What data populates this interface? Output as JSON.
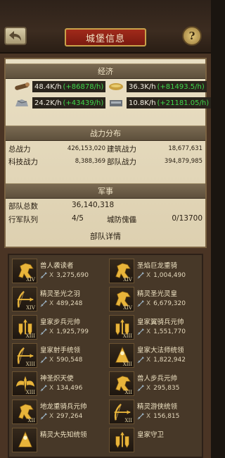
{
  "header": {
    "title": "城堡信息"
  },
  "economy": {
    "title": "经济",
    "resources": [
      {
        "icon": "wood-icon",
        "rate": "48.4K/h",
        "bonus": "(+86878/h)"
      },
      {
        "icon": "food-icon",
        "rate": "36.3K/h",
        "bonus": "(+81493.5/h)"
      },
      {
        "icon": "stone-icon",
        "rate": "24.2K/h",
        "bonus": "(+43439/h)"
      },
      {
        "icon": "iron-icon",
        "rate": "10.8K/h",
        "bonus": "(+21181.05/h)"
      }
    ]
  },
  "power": {
    "title": "战力分布",
    "total_label": "总战力",
    "total_value": "426,153,020",
    "building_label": "建筑战力",
    "building_value": "18,677,631",
    "tech_label": "科技战力",
    "tech_value": "8,388,369",
    "troop_label": "部队战力",
    "troop_value": "394,879,985"
  },
  "military": {
    "title": "军事",
    "troops_total_label": "部队总数",
    "troops_total_value": "36,140,318",
    "march_label": "行军队列",
    "march_value": "4/5",
    "trap_label": "城防傀儡",
    "trap_value": "0/13700",
    "detail_title": "部队详情"
  },
  "troops": [
    {
      "name": "兽人袭读者",
      "count": "3,275,690",
      "rank": "XIV",
      "kind": "cavalry"
    },
    {
      "name": "圣焰巨龙重骑",
      "count": "1,004,490",
      "rank": "XIV",
      "kind": "cavalry"
    },
    {
      "name": "精灵圣光之羽",
      "count": "489,248",
      "rank": "XIV",
      "kind": "archer"
    },
    {
      "name": "精灵圣光灵皇",
      "count": "6,679,320",
      "rank": "XIV",
      "kind": "cavalry"
    },
    {
      "name": "皇家步兵元帅",
      "count": "1,925,799",
      "rank": "XIII",
      "kind": "infantry"
    },
    {
      "name": "皇家翼骑兵元帅",
      "count": "1,551,770",
      "rank": "XIII",
      "kind": "infantry"
    },
    {
      "name": "皇家射手统领",
      "count": "590,548",
      "rank": "XIII",
      "kind": "archer"
    },
    {
      "name": "皇家大法师统领",
      "count": "1,822,942",
      "rank": "XIII",
      "kind": "mage"
    },
    {
      "name": "神圣炽天使",
      "count": "134,496",
      "rank": "XIII",
      "kind": "angel"
    },
    {
      "name": "兽人步兵元帅",
      "count": "295,835",
      "rank": "XII",
      "kind": "cavalry"
    },
    {
      "name": "地龙重骑兵元帅",
      "count": "297,264",
      "rank": "XII",
      "kind": "cavalry"
    },
    {
      "name": "精灵游侠统领",
      "count": "156,815",
      "rank": "XII",
      "kind": "archer"
    },
    {
      "name": "精灵大先知统领",
      "count": "",
      "rank": "",
      "kind": "mage"
    },
    {
      "name": "皇家守卫",
      "count": "",
      "rank": "",
      "kind": "infantry"
    }
  ]
}
